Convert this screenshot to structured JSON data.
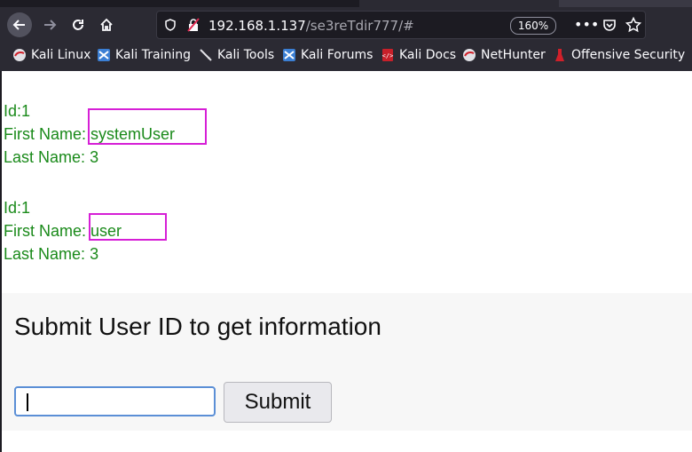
{
  "browser": {
    "url_host": "192.168.1.137",
    "url_path": "/se3reTdir777/#",
    "zoom": "160%",
    "bookmarks": [
      {
        "label": "Kali Linux",
        "icon": "kali-dragon-icon"
      },
      {
        "label": "Kali Training",
        "icon": "kali-training-icon"
      },
      {
        "label": "Kali Tools",
        "icon": "kali-tools-icon"
      },
      {
        "label": "Kali Forums",
        "icon": "kali-forums-icon"
      },
      {
        "label": "Kali Docs",
        "icon": "kali-docs-icon"
      },
      {
        "label": "NetHunter",
        "icon": "kali-dragon-icon"
      },
      {
        "label": "Offensive Security",
        "icon": "offsec-icon"
      }
    ]
  },
  "records": [
    {
      "id_label": "Id:1",
      "first_name_label": "First Name:",
      "first_name": "systemUser",
      "last_name_label": "Last Name:",
      "last_name": "3"
    },
    {
      "id_label": "Id:1",
      "first_name_label": "First Name:",
      "first_name": "user",
      "last_name_label": "Last Name:",
      "last_name": "3"
    }
  ],
  "form": {
    "title": "Submit User ID to get information",
    "input_value": "",
    "submit_label": "Submit"
  },
  "colors": {
    "record_text": "#1a8a1a",
    "highlight": "#d61fd6",
    "browser_chrome": "#2b2a33"
  }
}
